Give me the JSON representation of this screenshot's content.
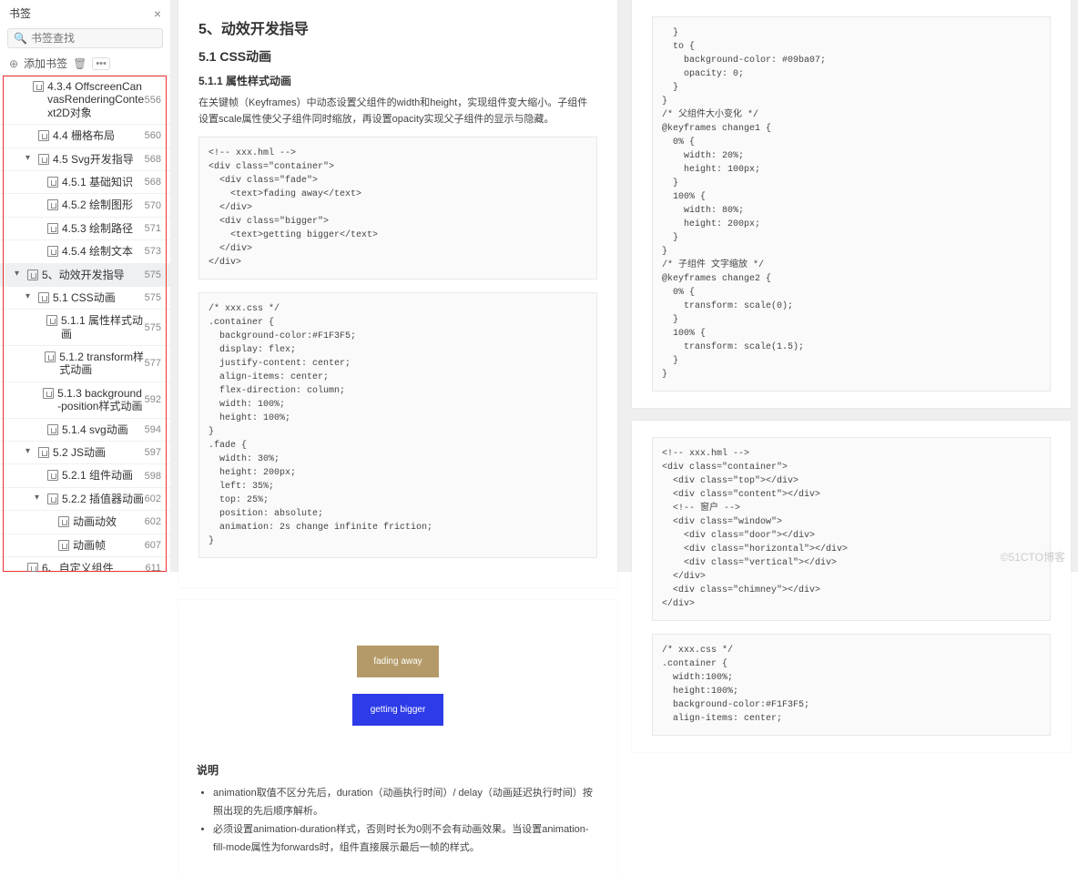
{
  "sidebar": {
    "title": "书签",
    "search_placeholder": "书签查找",
    "add_label": "添加书签",
    "items": [
      {
        "indent": 2,
        "arrow": "",
        "label": "4.3.4 OffscreenCanvasRenderingContext2D对象",
        "page": "556",
        "sel": false
      },
      {
        "indent": 2,
        "arrow": "",
        "label": "4.4 栅格布局",
        "page": "560",
        "sel": false
      },
      {
        "indent": 2,
        "arrow": "▾",
        "label": "4.5 Svg开发指导",
        "page": "568",
        "sel": false
      },
      {
        "indent": 3,
        "arrow": "",
        "label": "4.5.1 基础知识",
        "page": "568",
        "sel": false
      },
      {
        "indent": 3,
        "arrow": "",
        "label": "4.5.2 绘制图形",
        "page": "570",
        "sel": false
      },
      {
        "indent": 3,
        "arrow": "",
        "label": "4.5.3 绘制路径",
        "page": "571",
        "sel": false
      },
      {
        "indent": 3,
        "arrow": "",
        "label": "4.5.4 绘制文本",
        "page": "573",
        "sel": false
      },
      {
        "indent": 1,
        "arrow": "▾",
        "label": "5、动效开发指导",
        "page": "575",
        "sel": true
      },
      {
        "indent": 2,
        "arrow": "▾",
        "label": "5.1 CSS动画",
        "page": "575",
        "sel": false
      },
      {
        "indent": 3,
        "arrow": "",
        "label": "5.1.1 属性样式动画",
        "page": "575",
        "sel": false
      },
      {
        "indent": 3,
        "arrow": "",
        "label": "5.1.2 transform样式动画",
        "page": "577",
        "sel": false
      },
      {
        "indent": 3,
        "arrow": "",
        "label": "5.1.3 background-position样式动画",
        "page": "592",
        "sel": false
      },
      {
        "indent": 3,
        "arrow": "",
        "label": "5.1.4 svg动画",
        "page": "594",
        "sel": false
      },
      {
        "indent": 2,
        "arrow": "▾",
        "label": "5.2 JS动画",
        "page": "597",
        "sel": false
      },
      {
        "indent": 3,
        "arrow": "",
        "label": "5.2.1 组件动画",
        "page": "598",
        "sel": false
      },
      {
        "indent": 3,
        "arrow": "▾",
        "label": "5.2.2 插值器动画",
        "page": "602",
        "sel": false
      },
      {
        "indent": 4,
        "arrow": "",
        "label": "动画动效",
        "page": "602",
        "sel": false
      },
      {
        "indent": 4,
        "arrow": "",
        "label": "动画帧",
        "page": "607",
        "sel": false
      },
      {
        "indent": 1,
        "arrow": "",
        "label": "6、自定义组件",
        "page": "611",
        "sel": false
      }
    ]
  },
  "doc": {
    "h2": "5、动效开发指导",
    "h3": "5.1 CSS动画",
    "h4": "5.1.1 属性样式动画",
    "para": "在关键帧（Keyframes）中动态设置父组件的width和height，实现组件变大缩小。子组件设置scale属性使父子组件同时缩放，再设置opacity实现父子组件的显示与隐藏。",
    "code1": "<!-- xxx.hml -->\n<div class=\"container\">\n  <div class=\"fade\">\n    <text>fading away</text>\n  </div>\n  <div class=\"bigger\">\n    <text>getting bigger</text>\n  </div>\n</div>",
    "code2": "/* xxx.css */\n.container {\n  background-color:#F1F3F5;\n  display: flex;\n  justify-content: center;\n  align-items: center;\n  flex-direction: column;\n  width: 100%;\n  height: 100%;\n}\n.fade {\n  width: 30%;\n  height: 200px;\n  left: 35%;\n  top: 25%;\n  position: absolute;\n  animation: 2s change infinite friction;\n}",
    "code_right_top": "  }\n  to {\n    background-color: #09ba07;\n    opacity: 0;\n  }\n}\n/* 父组件大小变化 */\n@keyframes change1 {\n  0% {\n    width: 20%;\n    height: 100px;\n  }\n  100% {\n    width: 80%;\n    height: 200px;\n  }\n}\n/* 子组件 文字缩放 */\n@keyframes change2 {\n  0% {\n    transform: scale(0);\n  }\n  100% {\n    transform: scale(1.5);\n  }\n}",
    "preview_fade": "fading away",
    "preview_big": "getting bigger",
    "desc_head": "说明",
    "li1": "animation取值不区分先后，duration（动画执行时间）/ delay（动画延迟执行时间）按照出现的先后顺序解析。",
    "li2": "必须设置animation-duration样式，否则时长为0则不会有动画效果。当设置animation-fill-mode属性为forwards时，组件直接展示最后一帧的样式。",
    "code_right_b1": "<!-- xxx.hml -->\n<div class=\"container\">\n  <div class=\"top\"></div>\n  <div class=\"content\"></div>\n  <!-- 窗户 -->\n  <div class=\"window\">\n    <div class=\"door\"></div>\n    <div class=\"horizontal\"></div>\n    <div class=\"vertical\"></div>\n  </div>\n  <div class=\"chimney\"></div>\n</div>",
    "code_right_b2": "/* xxx.css */\n.container {\n  width:100%;\n  height:100%;\n  background-color:#F1F3F5;\n  align-items: center;"
  },
  "watermark": "©51CTO博客"
}
